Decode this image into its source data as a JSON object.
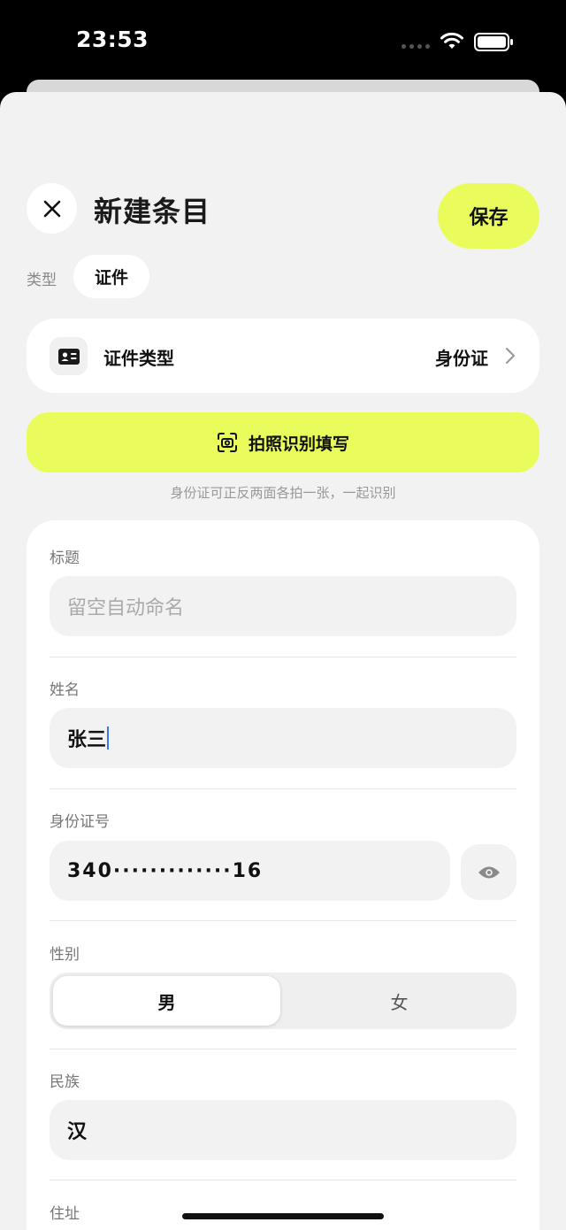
{
  "status_bar": {
    "time": "23:53"
  },
  "header": {
    "title": "新建条目",
    "save_label": "保存"
  },
  "type": {
    "label": "类型",
    "value": "证件"
  },
  "document_type": {
    "label": "证件类型",
    "value": "身份证"
  },
  "scan": {
    "label": "拍照识别填写",
    "hint": "身份证可正反两面各拍一张，一起识别"
  },
  "form": {
    "title": {
      "label": "标题",
      "placeholder": "留空自动命名"
    },
    "name": {
      "label": "姓名",
      "value": "张三"
    },
    "id_number": {
      "label": "身份证号",
      "value": "340·············16"
    },
    "gender": {
      "label": "性别",
      "options": [
        "男",
        "女"
      ],
      "selected": "男"
    },
    "ethnicity": {
      "label": "民族",
      "value": "汉"
    },
    "address": {
      "label": "住址"
    }
  },
  "colors": {
    "accent": "#eafc5c",
    "background": "#f2f2f2",
    "card": "#ffffff"
  }
}
